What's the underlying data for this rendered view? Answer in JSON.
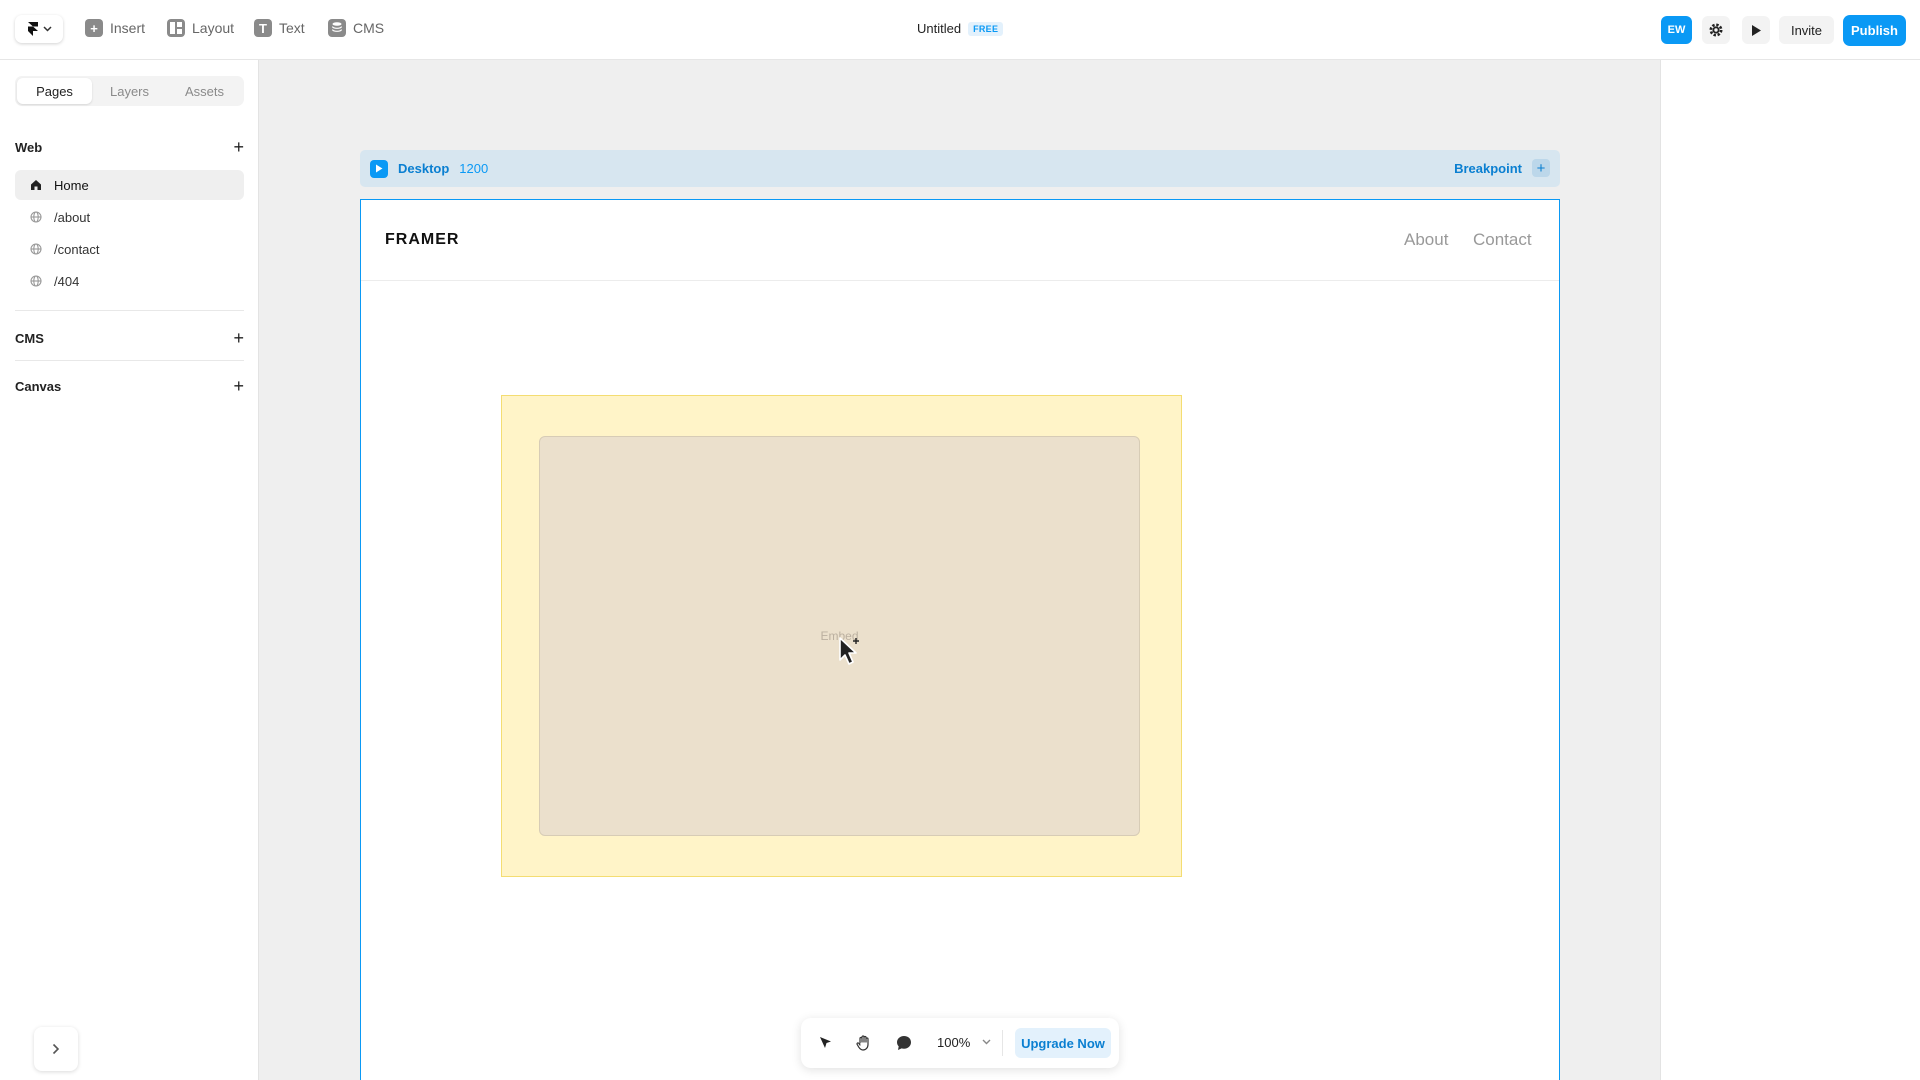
{
  "topbar": {
    "logo_icon": "framer-logo-icon",
    "tools": [
      {
        "label": "Insert",
        "icon": "plus-square-icon"
      },
      {
        "label": "Layout",
        "icon": "layout-icon"
      },
      {
        "label": "Text",
        "icon": "text-icon"
      },
      {
        "label": "CMS",
        "icon": "database-icon"
      }
    ],
    "project_title": "Untitled",
    "plan_badge": "FREE",
    "avatar_initials": "EW",
    "invite_label": "Invite",
    "publish_label": "Publish"
  },
  "sidebar": {
    "tabs": [
      {
        "label": "Pages",
        "active": true
      },
      {
        "label": "Layers",
        "active": false
      },
      {
        "label": "Assets",
        "active": false
      }
    ],
    "web_heading": "Web",
    "pages": [
      {
        "label": "Home",
        "icon": "home-icon",
        "active": true
      },
      {
        "label": "/about",
        "icon": "globe-icon",
        "active": false
      },
      {
        "label": "/contact",
        "icon": "globe-icon",
        "active": false
      },
      {
        "label": "/404",
        "icon": "globe-icon",
        "active": false
      }
    ],
    "cms_heading": "CMS",
    "canvas_heading": "Canvas"
  },
  "canvas": {
    "breakpoint_name": "Desktop",
    "breakpoint_width": "1200",
    "breakpoint_label": "Breakpoint",
    "site": {
      "brand": "FRAMER",
      "nav_links": [
        "About",
        "Contact"
      ]
    },
    "embed_label": "Embed"
  },
  "bottombar": {
    "zoom": "100%",
    "upgrade_label": "Upgrade Now"
  },
  "colors": {
    "accent": "#0a99f5",
    "embed_outer": "#fff4c8",
    "embed_inner": "#ebe0cc"
  }
}
